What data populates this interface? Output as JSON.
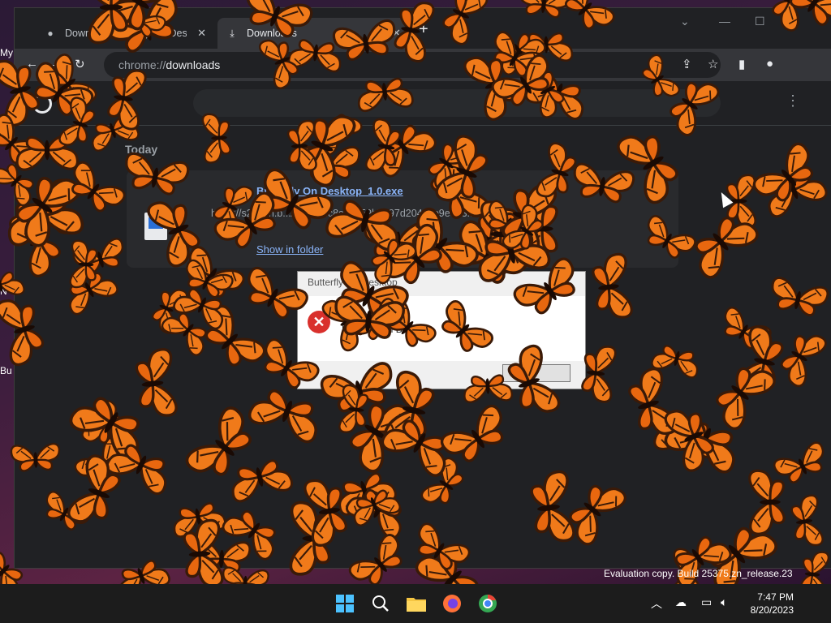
{
  "desktop": {
    "icons": [
      {
        "label": "My"
      },
      {
        "label": "N"
      },
      {
        "label": "Bu"
      }
    ]
  },
  "browser": {
    "tabs": [
      {
        "label": "Download Butterfly On Desktop",
        "active": false
      },
      {
        "label": "Downloads",
        "active": true
      }
    ],
    "address": {
      "scheme": "chrome://",
      "host": "downloads"
    },
    "downloads_page": {
      "section": "Today",
      "item": {
        "file_name": "Butterfly On Desktop_1.0.exe",
        "url": "https://s2ocdn.b.../32/2b...c8ce3a59b7e97d2041ce9e3b3...",
        "action": "Show in folder"
      }
    }
  },
  "dialog": {
    "title": "Butterfly On Desktop",
    "message": "Butterfly On Desktop",
    "ok_label": ""
  },
  "watermark": "Evaluation copy. Build 25375.zn_release.23",
  "taskbar": {
    "time": "7:47 PM",
    "date": "8/20/2023"
  },
  "colors": {
    "butterfly_orange": "#f07a1a",
    "butterfly_dark": "#3a1a08",
    "link_blue": "#8ab4f8",
    "error_red": "#d9302c"
  }
}
